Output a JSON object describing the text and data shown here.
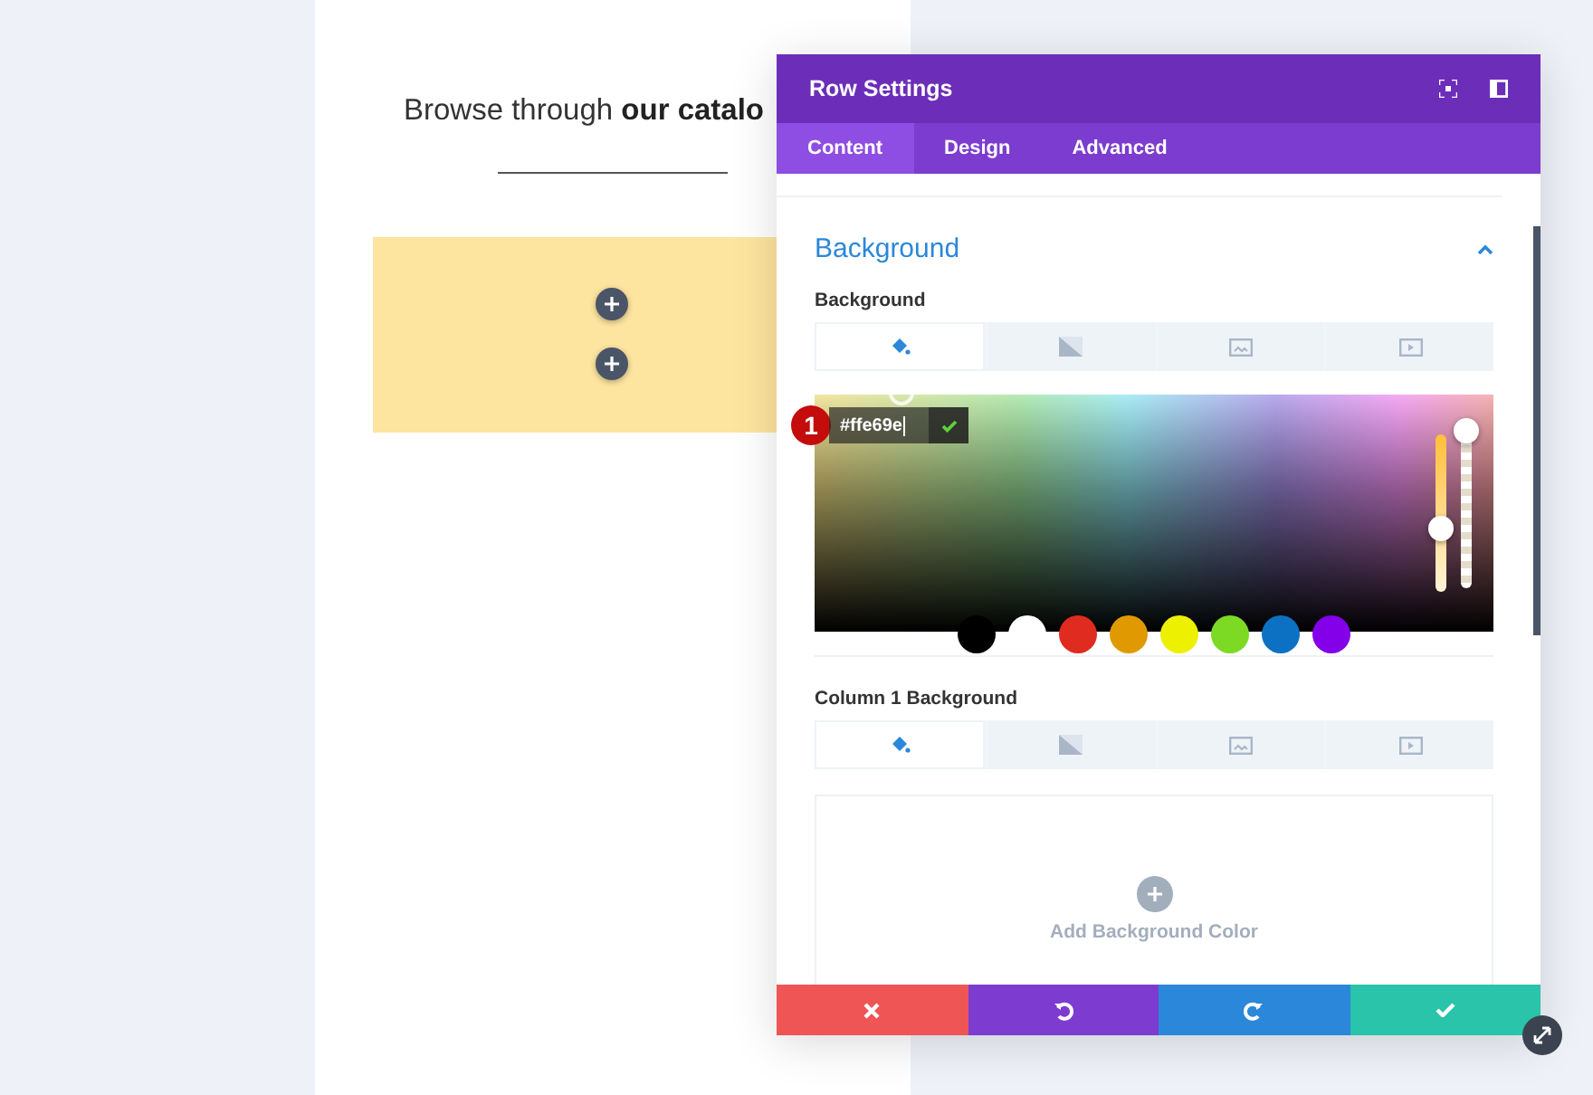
{
  "page": {
    "heading": "Browse through **our catalo**",
    "add_buttons": [
      {
        "kind": "add"
      },
      {
        "kind": "add"
      }
    ]
  },
  "dialog": {
    "title": "Row Settings",
    "tabs": [
      {
        "label": "Content",
        "selected": true
      },
      {
        "label": "Design",
        "selected": false
      },
      {
        "label": "Advanced",
        "selected": false
      }
    ],
    "section": {
      "title": "Background",
      "expanded": true
    },
    "fields": [
      {
        "label": "Background",
        "type_tabs": [
          {
            "kind": "color",
            "selected": true
          },
          {
            "kind": "gradient",
            "selected": false
          },
          {
            "kind": "image",
            "selected": false
          },
          {
            "kind": "video",
            "selected": false
          }
        ],
        "picker": {
          "hex": "#ffe69e",
          "badge": "1",
          "sliders": [
            {
              "kind": "hue",
              "level": 0.4
            },
            {
              "kind": "opacity",
              "level": 1
            }
          ],
          "swatches": [
            {
              "color": "#000000"
            },
            {
              "color": "#ffffff"
            },
            {
              "color": "#e02b20"
            },
            {
              "color": "#e09900"
            },
            {
              "color": "#edf000"
            },
            {
              "color": "#7cda24"
            },
            {
              "color": "#0c71c3"
            },
            {
              "color": "#8300e9"
            }
          ]
        }
      },
      {
        "label": "Column 1 Background",
        "type_tabs": [
          {
            "kind": "color",
            "selected": true
          },
          {
            "kind": "gradient",
            "selected": false
          },
          {
            "kind": "image",
            "selected": false
          },
          {
            "kind": "video",
            "selected": false
          }
        ],
        "empty": {
          "label": "Add Background Color"
        }
      }
    ],
    "footer": [
      {
        "kind": "cancel"
      },
      {
        "kind": "undo"
      },
      {
        "kind": "redo"
      },
      {
        "kind": "save"
      }
    ]
  }
}
